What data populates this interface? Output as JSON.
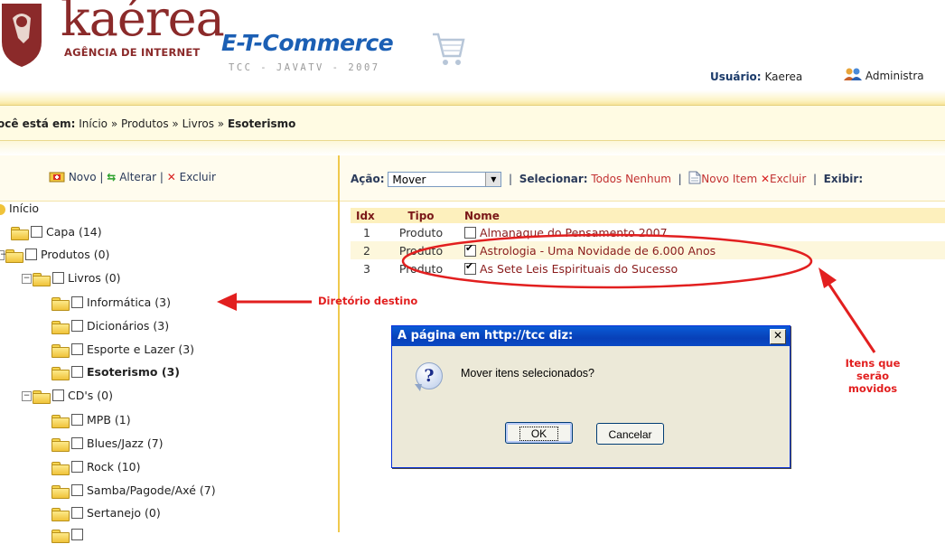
{
  "header": {
    "logo_name": "kaérea",
    "logo_subtitle": "AGÊNCIA DE INTERNET",
    "brand_title": "E-T-Commerce",
    "brand_subtitle": "TCC - JAVATV - 2007",
    "user_label": "Usuário:",
    "user_name": "Kaerea",
    "admin_label": "Administra"
  },
  "breadcrumb": {
    "prefix": "ocê está em:",
    "items": [
      "Início",
      "Produtos",
      "Livros"
    ],
    "separator": "»",
    "current": "Esoterismo"
  },
  "tree_toolbar": {
    "new_label": "Novo",
    "edit_label": "Alterar",
    "delete_label": "Excluir",
    "sep": "|"
  },
  "tree": {
    "root": "Início",
    "nodes": [
      {
        "label": "Capa (14)"
      },
      {
        "label": "Produtos (0)"
      },
      {
        "label": "Livros (0)"
      },
      {
        "label": "Informática (3)"
      },
      {
        "label": "Dicionários (3)"
      },
      {
        "label": "Esporte e Lazer (3)"
      },
      {
        "label": "Esoterismo (3)"
      },
      {
        "label": "CD's (0)"
      },
      {
        "label": "MPB (1)"
      },
      {
        "label": "Blues/Jazz (7)"
      },
      {
        "label": "Rock (10)"
      },
      {
        "label": "Samba/Pagode/Axé (7)"
      },
      {
        "label": "Sertanejo (0)"
      }
    ]
  },
  "action_toolbar": {
    "action_label": "Ação:",
    "action_value": "Mover",
    "select_label": "Selecionar:",
    "select_all": "Todos",
    "select_none": "Nenhum",
    "new_item": "Novo Item",
    "delete": "Excluir",
    "show_label": "Exibir:"
  },
  "table": {
    "headers": [
      "Idx",
      "Tipo",
      "Nome"
    ],
    "rows": [
      {
        "idx": "1",
        "tipo": "Produto",
        "nome": "Almanaque do Pensamento 2007",
        "checked": false
      },
      {
        "idx": "2",
        "tipo": "Produto",
        "nome": "Astrologia - Uma Novidade de 6.000 Anos",
        "checked": true
      },
      {
        "idx": "3",
        "tipo": "Produto",
        "nome": "As Sete Leis Espirituais do Sucesso",
        "checked": true
      }
    ]
  },
  "annotations": {
    "dest_dir": "Diretório destino",
    "items_moved_1": "Itens que serão",
    "items_moved_2": "movidos",
    "color": "#e21f1f"
  },
  "dialog": {
    "title": "A página em http://tcc diz:",
    "message": "Mover itens selecionados?",
    "ok": "OK",
    "cancel": "Cancelar",
    "close": "✕"
  }
}
